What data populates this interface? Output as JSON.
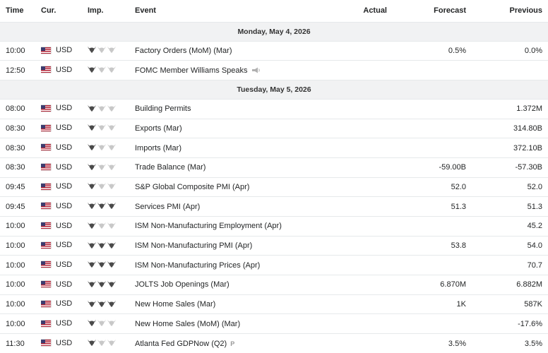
{
  "headers": {
    "time": "Time",
    "currency": "Cur.",
    "importance": "Imp.",
    "event": "Event",
    "actual": "Actual",
    "forecast": "Forecast",
    "previous": "Previous"
  },
  "colors": {
    "bull_active": "#4a4a4a",
    "bull_inactive": "#c8c8c8",
    "day_bg": "#f1f2f3",
    "border": "#e6e9eb"
  },
  "days": [
    {
      "label": "Monday, May 4, 2026",
      "events": [
        {
          "time": "10:00",
          "currency": "USD",
          "importance": 1,
          "event": "Factory Orders (MoM) (Mar)",
          "icon": "",
          "actual": "",
          "forecast": "0.5%",
          "previous": "0.0%"
        },
        {
          "time": "12:50",
          "currency": "USD",
          "importance": 1,
          "event": "FOMC Member Williams Speaks",
          "icon": "speech-icon",
          "actual": "",
          "forecast": "",
          "previous": ""
        }
      ]
    },
    {
      "label": "Tuesday, May 5, 2026",
      "events": [
        {
          "time": "08:00",
          "currency": "USD",
          "importance": 1,
          "event": "Building Permits",
          "icon": "",
          "actual": "",
          "forecast": "",
          "previous": "1.372M"
        },
        {
          "time": "08:30",
          "currency": "USD",
          "importance": 1,
          "event": "Exports (Mar)",
          "icon": "",
          "actual": "",
          "forecast": "",
          "previous": "314.80B"
        },
        {
          "time": "08:30",
          "currency": "USD",
          "importance": 1,
          "event": "Imports (Mar)",
          "icon": "",
          "actual": "",
          "forecast": "",
          "previous": "372.10B"
        },
        {
          "time": "08:30",
          "currency": "USD",
          "importance": 1,
          "event": "Trade Balance (Mar)",
          "icon": "",
          "actual": "",
          "forecast": "-59.00B",
          "previous": "-57.30B"
        },
        {
          "time": "09:45",
          "currency": "USD",
          "importance": 1,
          "event": "S&P Global Composite PMI (Apr)",
          "icon": "",
          "actual": "",
          "forecast": "52.0",
          "previous": "52.0"
        },
        {
          "time": "09:45",
          "currency": "USD",
          "importance": 3,
          "event": "Services PMI (Apr)",
          "icon": "",
          "actual": "",
          "forecast": "51.3",
          "previous": "51.3"
        },
        {
          "time": "10:00",
          "currency": "USD",
          "importance": 1,
          "event": "ISM Non-Manufacturing Employment (Apr)",
          "icon": "",
          "actual": "",
          "forecast": "",
          "previous": "45.2"
        },
        {
          "time": "10:00",
          "currency": "USD",
          "importance": 3,
          "event": "ISM Non-Manufacturing PMI (Apr)",
          "icon": "",
          "actual": "",
          "forecast": "53.8",
          "previous": "54.0"
        },
        {
          "time": "10:00",
          "currency": "USD",
          "importance": 3,
          "event": "ISM Non-Manufacturing Prices (Apr)",
          "icon": "",
          "actual": "",
          "forecast": "",
          "previous": "70.7"
        },
        {
          "time": "10:00",
          "currency": "USD",
          "importance": 3,
          "event": "JOLTS Job Openings (Mar)",
          "icon": "",
          "actual": "",
          "forecast": "6.870M",
          "previous": "6.882M"
        },
        {
          "time": "10:00",
          "currency": "USD",
          "importance": 3,
          "event": "New Home Sales (Mar)",
          "icon": "",
          "actual": "",
          "forecast": "1K",
          "previous": "587K"
        },
        {
          "time": "10:00",
          "currency": "USD",
          "importance": 1,
          "event": "New Home Sales (MoM) (Mar)",
          "icon": "",
          "actual": "",
          "forecast": "",
          "previous": "-17.6%"
        },
        {
          "time": "11:30",
          "currency": "USD",
          "importance": 1,
          "event": "Atlanta Fed GDPNow (Q2)",
          "icon": "preliminary-icon",
          "icon_text": "P",
          "actual": "",
          "forecast": "3.5%",
          "previous": "3.5%"
        }
      ]
    }
  ]
}
